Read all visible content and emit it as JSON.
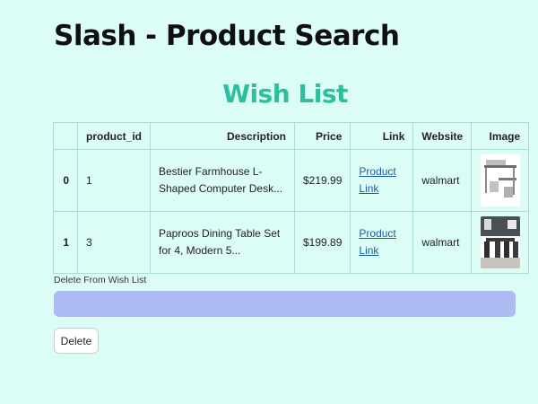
{
  "header": {
    "app_title": "Slash - Product Search"
  },
  "wishlist": {
    "title": "Wish List",
    "columns": [
      "",
      "product_id",
      "Description",
      "Price",
      "Link",
      "Website",
      "Image"
    ],
    "rows": [
      {
        "index": "0",
        "product_id": "1",
        "description": "Bestier Farmhouse L-Shaped Computer Desk...",
        "price": "$219.99",
        "link": "Product Link",
        "website": "walmart",
        "image": "desk-product-thumbnail"
      },
      {
        "index": "1",
        "product_id": "3",
        "description": "Paproos Dining Table Set for 4, Modern 5...",
        "price": "$199.89",
        "link": "Product Link",
        "website": "walmart",
        "image": "dining-set-product-thumbnail"
      }
    ]
  },
  "delete": {
    "label": "Delete From Wish List",
    "selected_value": "",
    "button_label": "Delete"
  },
  "colors": {
    "background": "#dcfdf6",
    "accent_title": "#2bbf9e",
    "select_fill": "#aebbf3",
    "link": "#1a5fa8"
  }
}
